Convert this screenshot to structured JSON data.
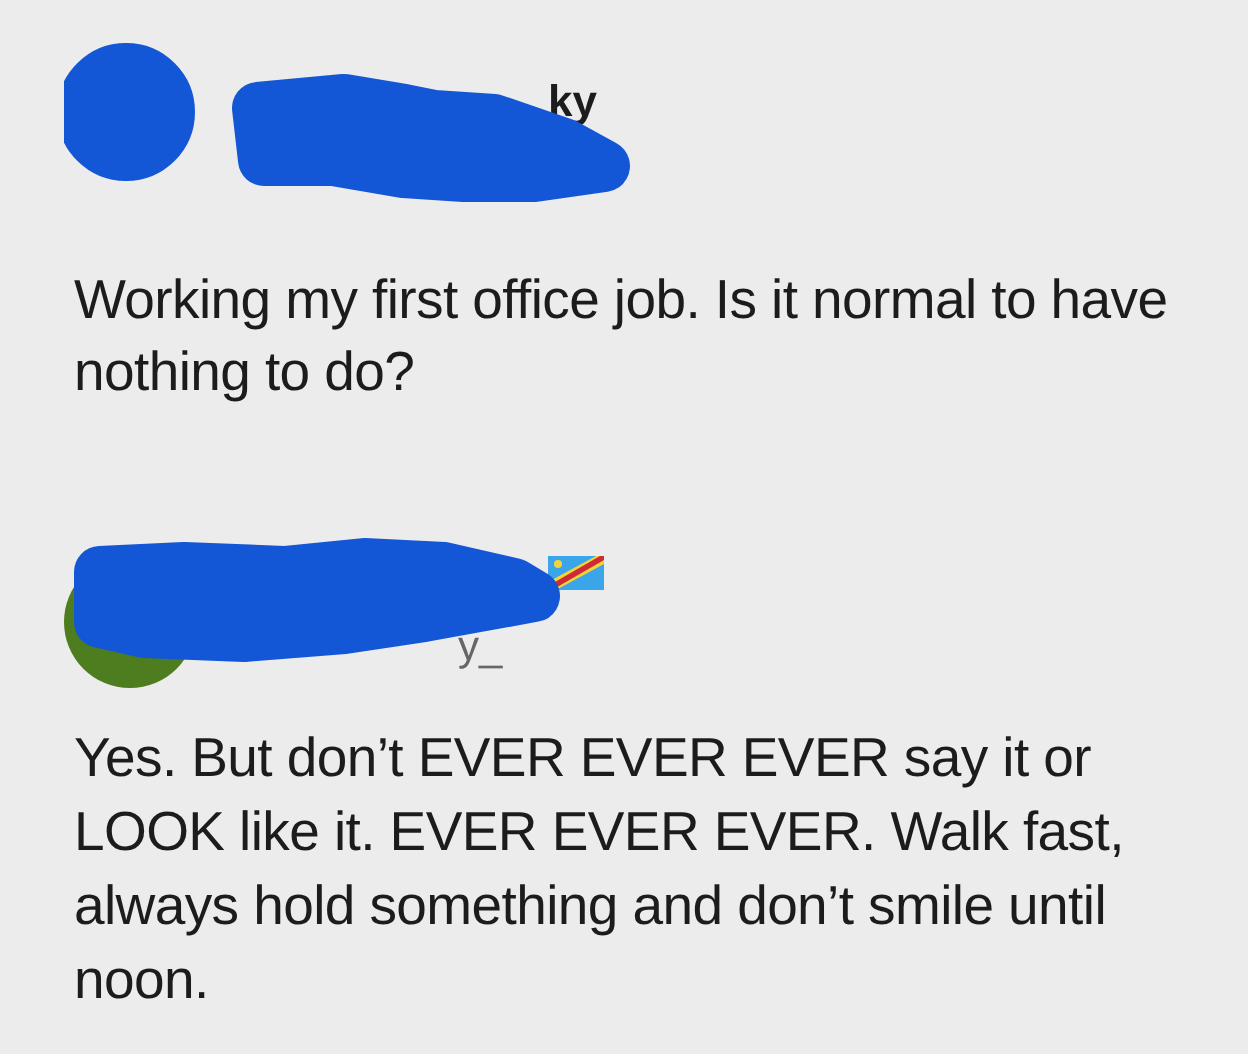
{
  "posts": [
    {
      "name_fragment": "ky",
      "flag": false,
      "body": "Working my first office job. Is it normal to have nothing to do?"
    },
    {
      "handle_fragment": "y_",
      "flag": true,
      "body": "Yes. But don’t EVER EVER EVER say it or LOOK like it. EVER EVER EVER. Walk fast, always hold something and don’t smile until noon."
    }
  ]
}
